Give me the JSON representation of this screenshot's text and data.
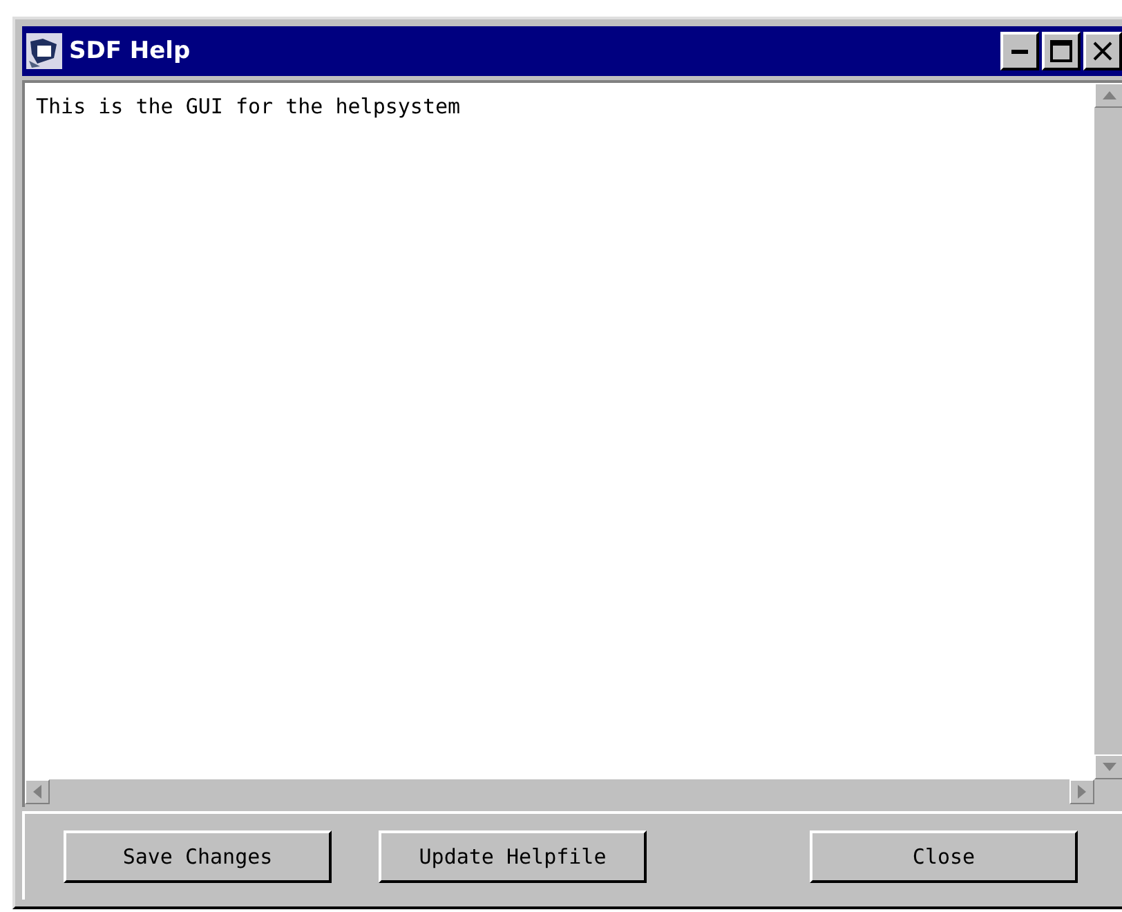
{
  "window": {
    "title": "SDF Help"
  },
  "text_area": {
    "value": "This is the GUI for the helpsystem"
  },
  "buttons": [
    {
      "label": "Save Changes",
      "kind": "left"
    },
    {
      "label": "Update Helpfile",
      "kind": "left"
    },
    {
      "label": "Close",
      "kind": "right"
    }
  ]
}
